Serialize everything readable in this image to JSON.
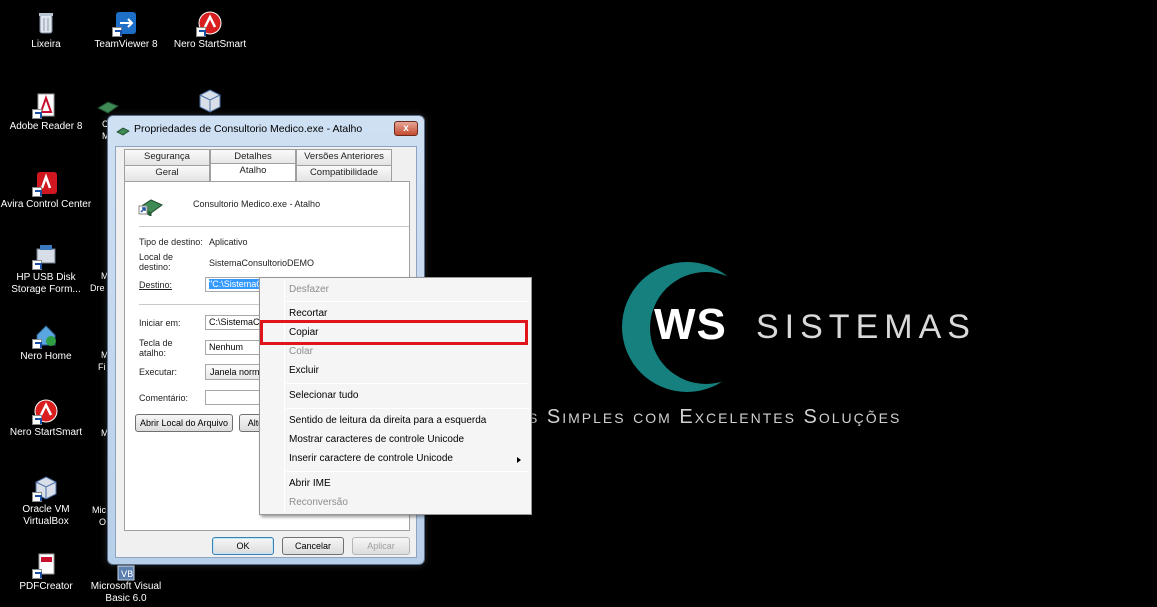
{
  "desktop": {
    "icons": [
      {
        "label": "Lixeira",
        "icon": "recycle-bin-icon"
      },
      {
        "label": "TeamViewer 8",
        "icon": "teamviewer-icon"
      },
      {
        "label": "Nero StartSmart",
        "icon": "nero-icon"
      },
      {
        "label": "Adobe Reader 8",
        "icon": "adobe-reader-icon"
      },
      {
        "label": "Avira Control Center",
        "icon": "avira-icon"
      },
      {
        "label": "HP USB Disk Storage Form...",
        "icon": "usb-disk-icon"
      },
      {
        "label": "Nero Home",
        "icon": "nero-home-icon"
      },
      {
        "label": "Nero StartSmart",
        "icon": "nero-icon"
      },
      {
        "label": "Oracle VM VirtualBox",
        "icon": "virtualbox-icon"
      },
      {
        "label": "PDFCreator",
        "icon": "pdfcreator-icon"
      },
      {
        "label": "Microsoft Visual Basic 6.0",
        "icon": "visual-basic-icon"
      }
    ],
    "partial_labels": [
      "C",
      "M",
      "M",
      "Dre",
      "M",
      "Fi",
      "M",
      "Mic",
      "O"
    ]
  },
  "logo": {
    "ws": "WS",
    "sistemas": "SISTEMAS",
    "tagline": "s Simples com Excelentes Soluções",
    "accent": "#15807e"
  },
  "dialog": {
    "title": "Propriedades de Consultorio Medico.exe - Atalho",
    "close": "x",
    "tabs_back": [
      "Segurança",
      "Detalhes",
      "Versões Anteriores"
    ],
    "tabs_front": [
      "Geral",
      "Atalho",
      "Compatibilidade"
    ],
    "active_tab": "Atalho",
    "header_name": "Consultorio Medico.exe - Atalho",
    "target_type_label": "Tipo de destino:",
    "target_type_value": "Aplicativo",
    "target_location_label": "Local de destino:",
    "target_location_value": "SistemaConsultorioDEMO",
    "target_label": "Destino:",
    "target_value": "\"C:\\SistemaCon",
    "start_in_label": "Iniciar em:",
    "start_in_value": "C:\\SistemaCon",
    "shortcut_key_label": "Tecla de atalho:",
    "shortcut_key_value": "Nenhum",
    "run_label": "Executar:",
    "run_value": "Janela normal",
    "comment_label": "Comentário:",
    "comment_value": "",
    "open_location_button": "Abrir Local do Arquivo",
    "change_icon_button": "Alter",
    "ok_button": "OK",
    "cancel_button": "Cancelar",
    "apply_button": "Aplicar"
  },
  "context_menu": {
    "undo": "Desfazer",
    "cut": "Recortar",
    "copy": "Copiar",
    "paste": "Colar",
    "delete": "Excluir",
    "select_all": "Selecionar tudo",
    "rtl": "Sentido de leitura da direita para a esquerda",
    "show_unicode": "Mostrar caracteres de controle Unicode",
    "insert_unicode": "Inserir caractere de controle Unicode",
    "open_ime": "Abrir IME",
    "reconversion": "Reconversão",
    "highlight_color": "#e0141b"
  }
}
